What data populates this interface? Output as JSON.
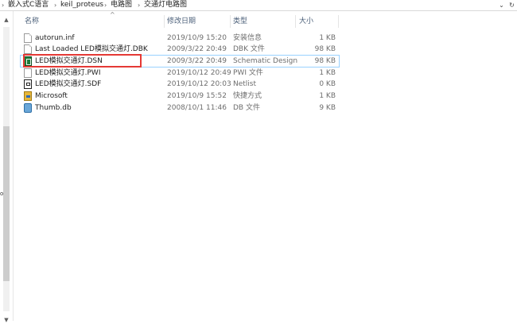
{
  "breadcrumb": [
    "嵌入式C语言",
    "keil_proteus",
    "电路图",
    "交通灯电路图"
  ],
  "columns": {
    "name": "名称",
    "date": "修改日期",
    "type": "类型",
    "size": "大小"
  },
  "files": [
    {
      "name": "autorun.inf",
      "date": "2019/10/9 15:20",
      "type": "安装信息",
      "size": "1 KB",
      "icon": "document-icon"
    },
    {
      "name": "Last Loaded LED模拟交通灯.DBK",
      "date": "2009/3/22 20:49",
      "type": "DBK 文件",
      "size": "98 KB",
      "icon": "document-icon"
    },
    {
      "name": "LED模拟交通灯.DSN",
      "date": "2009/3/22 20:49",
      "type": "Schematic Design",
      "size": "98 KB",
      "icon": "schematic-icon",
      "selected": true
    },
    {
      "name": "LED模拟交通灯.PWI",
      "date": "2019/10/12 20:49",
      "type": "PWI 文件",
      "size": "1 KB",
      "icon": "document-icon"
    },
    {
      "name": "LED模拟交通灯.SDF",
      "date": "2019/10/12 20:03",
      "type": "Netlist",
      "size": "0 KB",
      "icon": "netlist-icon"
    },
    {
      "name": "Microsoft",
      "date": "2019/10/9 15:52",
      "type": "快捷方式",
      "size": "1 KB",
      "icon": "shortcut-icon"
    },
    {
      "name": "Thumb.db",
      "date": "2008/10/1 11:46",
      "type": "DB 文件",
      "size": "9 KB",
      "icon": "database-icon"
    }
  ],
  "left_edge_text": "o",
  "accent": {
    "highlight": "#e53935",
    "selection": "#99d1ff",
    "header_text": "#4c607a"
  }
}
